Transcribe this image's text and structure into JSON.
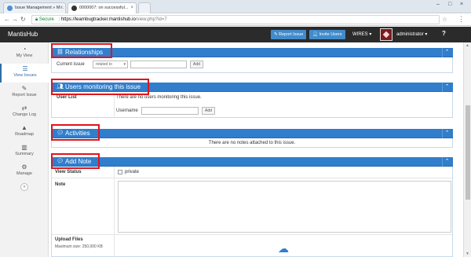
{
  "browser": {
    "tabs": [
      {
        "label": "Issue Management » M...",
        "active": false,
        "favicon_color": "#4a90d9"
      },
      {
        "label": "0000007: on successful...",
        "active": true,
        "favicon_color": "#333333"
      },
      {
        "label": "",
        "active": false,
        "favicon_color": "#cccccc"
      }
    ],
    "secure_label": "Secure",
    "url_domain": "https://learnbugtracker.mantishub.io",
    "url_path": "/view.php?id=7"
  },
  "navbar": {
    "brand": "MantisHub",
    "report_issue": "Report Issue",
    "invite_users": "Invite Users",
    "project": "WIRES",
    "username": "administrator",
    "help": "?"
  },
  "sidebar": {
    "items": [
      {
        "label": "My View",
        "icon": "tachometer-icon",
        "glyph": "◔"
      },
      {
        "label": "View Issues",
        "icon": "list-icon",
        "glyph": "☰"
      },
      {
        "label": "Report Issue",
        "icon": "edit-icon",
        "glyph": "✎"
      },
      {
        "label": "Change Log",
        "icon": "retweet-icon",
        "glyph": "⇄"
      },
      {
        "label": "Roadmap",
        "icon": "road-icon",
        "glyph": "▲"
      },
      {
        "label": "Summary",
        "icon": "bar-chart-icon",
        "glyph": "▥"
      },
      {
        "label": "Manage",
        "icon": "gears-icon",
        "glyph": "⚙"
      }
    ],
    "active_index": 1,
    "collapse_glyph": "«"
  },
  "relationships": {
    "title": "Relationships",
    "current_issue_label": "Current issue",
    "relation_select": "related to",
    "add_button": "Add"
  },
  "monitoring": {
    "title": "Users monitoring this issue",
    "user_list_label": "User List",
    "empty_text": "There are no users monitoring this issue.",
    "username_label": "Username",
    "add_button": "Add"
  },
  "activities": {
    "title": "Activities",
    "empty_text": "There are no notes attached to this issue."
  },
  "add_note": {
    "title": "Add Note",
    "view_status_label": "View Status",
    "private_label": "private",
    "note_label": "Note",
    "upload_label": "Upload Files",
    "max_size_label": "Maximum size: 250,000 KB"
  },
  "colors": {
    "accent": "#307ecc",
    "highlight": "#e0151c",
    "navbar": "#2b2b2b"
  }
}
